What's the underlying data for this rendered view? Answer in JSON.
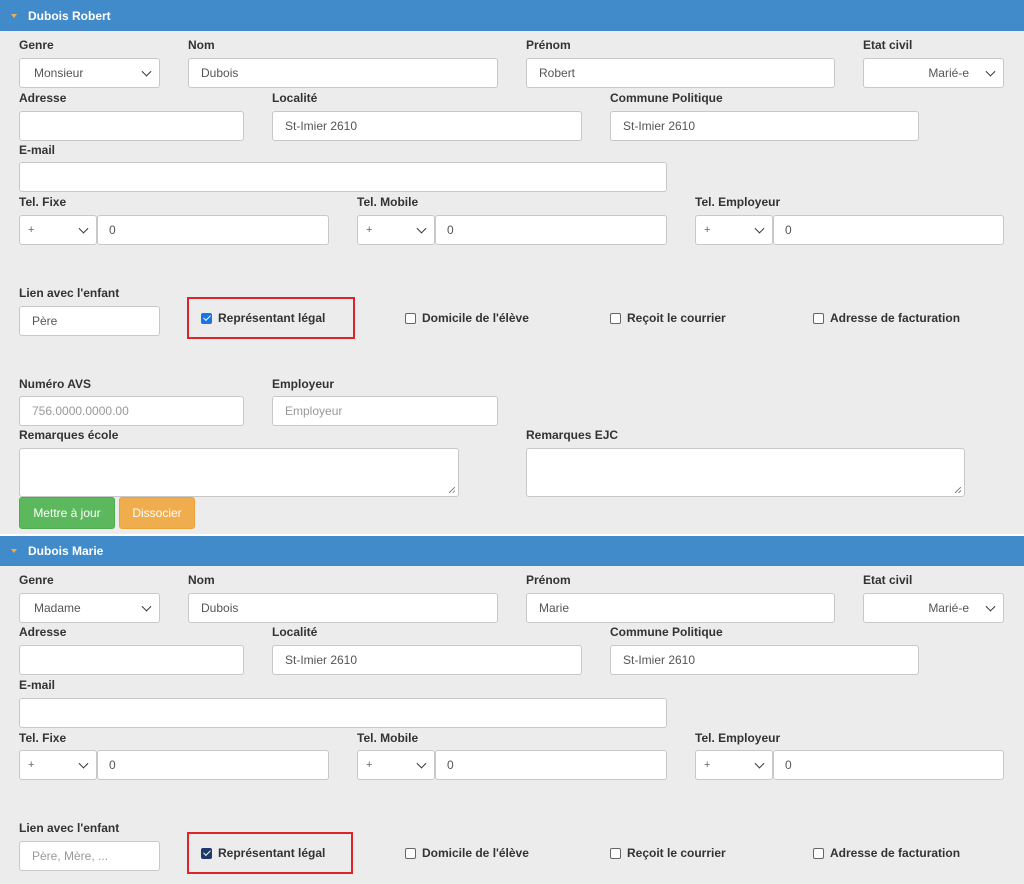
{
  "labels": {
    "genre": "Genre",
    "nom": "Nom",
    "prenom": "Prénom",
    "etat_civil": "Etat civil",
    "adresse": "Adresse",
    "localite": "Localité",
    "commune": "Commune Politique",
    "email": "E-mail",
    "tel_fixe": "Tel. Fixe",
    "tel_mobile": "Tel. Mobile",
    "tel_employeur": "Tel. Employeur",
    "lien": "Lien avec l'enfant",
    "representant": "Représentant légal",
    "domicile": "Domicile de l'élève",
    "courrier": "Reçoit le courrier",
    "facturation": "Adresse de facturation",
    "avs": "Numéro AVS",
    "employeur": "Employeur",
    "remarques_ecole": "Remarques école",
    "remarques_ejc": "Remarques EJC"
  },
  "persons": [
    {
      "header": "Dubois Robert",
      "genre": "Monsieur",
      "nom": "Dubois",
      "prenom": "Robert",
      "etat_civil": "Marié-e",
      "adresse": "",
      "localite": "St-Imier 2610",
      "commune": "St-Imier 2610",
      "email": "",
      "tel_fixe_prefix": "+",
      "tel_fixe": "0",
      "tel_mobile_prefix": "+",
      "tel_mobile": "0",
      "tel_employeur_prefix": "+",
      "tel_employeur": "0",
      "lien": "Père",
      "representant_legal": true,
      "domicile": false,
      "courrier": false,
      "facturation": false,
      "avs_placeholder": "756.0000.0000.00",
      "employeur_placeholder": "Employeur",
      "btn_update": "Mettre à jour",
      "btn_dissocier": "Dissocier"
    },
    {
      "header": "Dubois Marie",
      "genre": "Madame",
      "nom": "Dubois",
      "prenom": "Marie",
      "etat_civil": "Marié-e",
      "adresse": "",
      "localite": "St-Imier 2610",
      "commune": "St-Imier 2610",
      "email": "",
      "tel_fixe_prefix": "+",
      "tel_fixe": "0",
      "tel_mobile_prefix": "+",
      "tel_mobile": "0",
      "tel_employeur_prefix": "+",
      "tel_employeur": "0",
      "lien_placeholder": "Père, Mère, ...",
      "representant_legal": true,
      "domicile": false,
      "courrier": false,
      "facturation": false
    }
  ],
  "colors": {
    "header": "#428bca",
    "panel": "#ececec",
    "highlight": "#e0232b",
    "btn_update": "#5cb85c",
    "btn_dissocier": "#f0ad4e"
  }
}
